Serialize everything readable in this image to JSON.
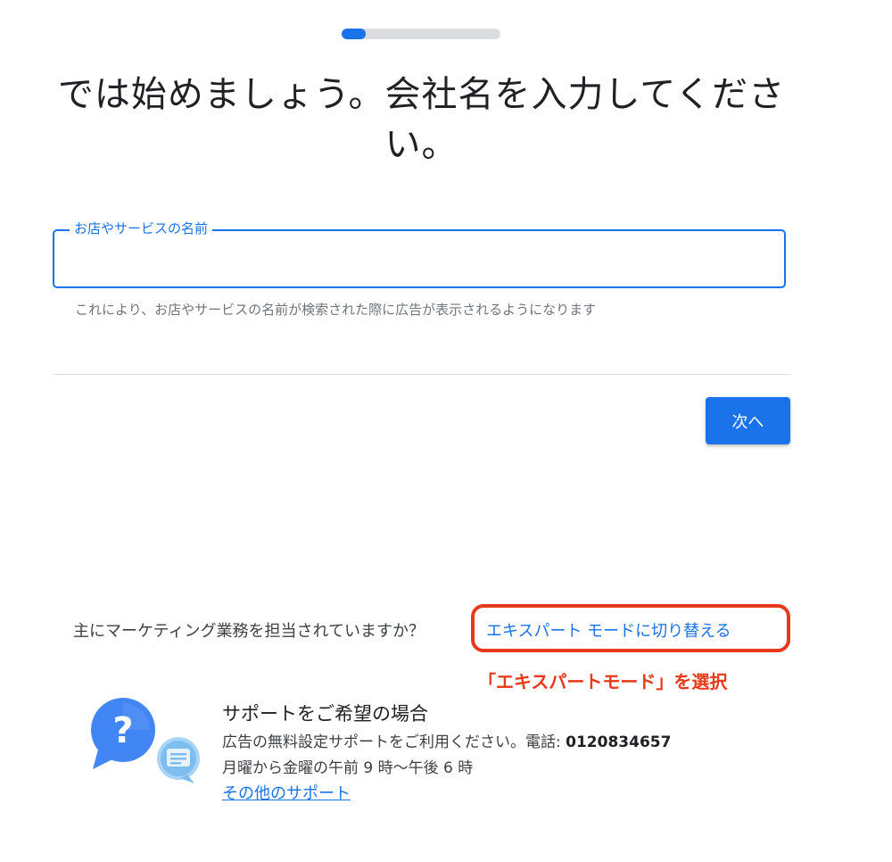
{
  "progress": {
    "fraction": 0.15,
    "color": "#1a73e8",
    "track_color": "#dadce0"
  },
  "title": {
    "line1": "では始めましょう。会社名を入力してくださ",
    "line2": "い。"
  },
  "business_name_field": {
    "label": "お店やサービスの名前",
    "value": "",
    "helper": "これにより、お店やサービスの名前が検索された際に広告が表示されるようになります"
  },
  "next_button": {
    "label": "次へ"
  },
  "expert_mode": {
    "question": "主にマーケティング業務を担当されていますか？",
    "link": "エキスパート モードに切り替える"
  },
  "annotation": {
    "text": "「エキスパートモード」を選択",
    "color": "#e8391a"
  },
  "support": {
    "title": "サポートをご希望の場合",
    "line1_prefix": "広告の無料設定サポートをご利用ください。電話: ",
    "phone": "0120834657",
    "hours": "月曜から金曜の午前 9 時〜午後 6 時",
    "more_link": "その他のサポート",
    "icon": "help-chat-icon"
  },
  "colors": {
    "accent": "#1a73e8",
    "highlight": "#e8391a"
  }
}
